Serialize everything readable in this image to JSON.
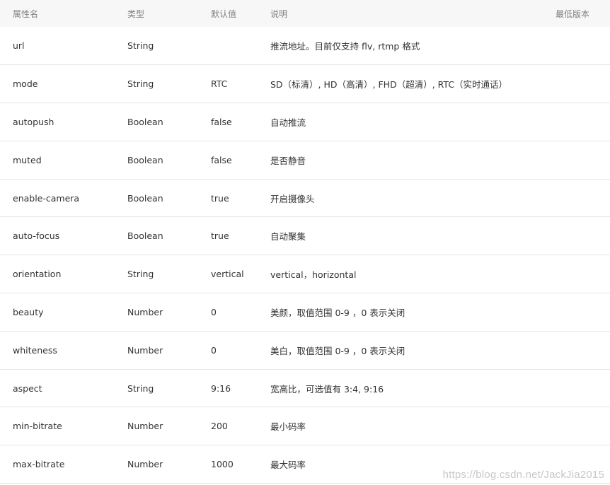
{
  "table": {
    "headers": [
      "属性名",
      "类型",
      "默认值",
      "说明",
      "最低版本"
    ],
    "rows": [
      {
        "name": "url",
        "type": "String",
        "default": "",
        "desc": "推流地址。目前仅支持 flv, rtmp 格式",
        "version": ""
      },
      {
        "name": "mode",
        "type": "String",
        "default": "RTC",
        "desc": "SD（标清）, HD（高清）, FHD（超清）, RTC（实时通话）",
        "version": ""
      },
      {
        "name": "autopush",
        "type": "Boolean",
        "default": "false",
        "desc": "自动推流",
        "version": ""
      },
      {
        "name": "muted",
        "type": "Boolean",
        "default": "false",
        "desc": "是否静音",
        "version": ""
      },
      {
        "name": "enable-camera",
        "type": "Boolean",
        "default": "true",
        "desc": "开启摄像头",
        "version": ""
      },
      {
        "name": "auto-focus",
        "type": "Boolean",
        "default": "true",
        "desc": "自动聚集",
        "version": ""
      },
      {
        "name": "orientation",
        "type": "String",
        "default": "vertical",
        "desc": "vertical，horizontal",
        "version": ""
      },
      {
        "name": "beauty",
        "type": "Number",
        "default": "0",
        "desc": "美颜，取值范围 0-9 ，0 表示关闭",
        "version": ""
      },
      {
        "name": "whiteness",
        "type": "Number",
        "default": "0",
        "desc": "美白，取值范围 0-9 ，0 表示关闭",
        "version": ""
      },
      {
        "name": "aspect",
        "type": "String",
        "default": "9:16",
        "desc": "宽高比，可选值有 3:4, 9:16",
        "version": ""
      },
      {
        "name": "min-bitrate",
        "type": "Number",
        "default": "200",
        "desc": "最小码率",
        "version": ""
      },
      {
        "name": "max-bitrate",
        "type": "Number",
        "default": "1000",
        "desc": "最大码率",
        "version": ""
      }
    ]
  },
  "watermark": "https://blog.csdn.net/JackJia2015"
}
